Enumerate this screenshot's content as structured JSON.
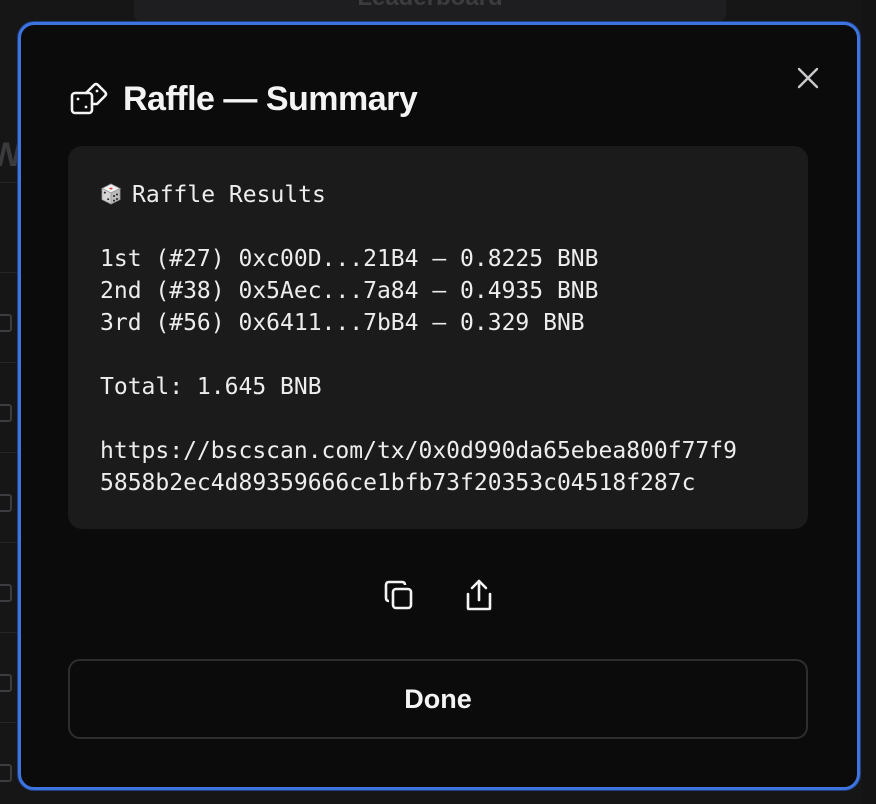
{
  "background": {
    "leaderboard_label": "Leaderboard",
    "left_glyph": "W"
  },
  "modal": {
    "header_icon": "dice-tag-icon",
    "title": "Raffle — Summary",
    "close_icon": "close-icon",
    "results": {
      "heading_icon": "game-die-icon",
      "heading": "Raffle Results",
      "winners": [
        "1st (#27) 0xc00D...21B4 — 0.8225 BNB",
        "2nd (#38) 0x5Aec...7a84 — 0.4935 BNB",
        "3rd (#56) 0x6411...7bB4 — 0.329 BNB"
      ],
      "total": "Total: 1.645 BNB",
      "tx_link_lines": [
        "https://bscscan.com/tx/0x0d990da65ebea800f77f9",
        "5858b2ec4d89359666ce1bfb73f20353c04518f287c"
      ]
    },
    "actions": {
      "copy_icon": "copy-icon",
      "share_icon": "share-icon"
    },
    "done_label": "Done"
  },
  "colors": {
    "modal_border": "#3e74e0",
    "modal_bg": "#0b0b0c",
    "result_bg": "#1b1b1c",
    "text": "#f4f4f5"
  }
}
